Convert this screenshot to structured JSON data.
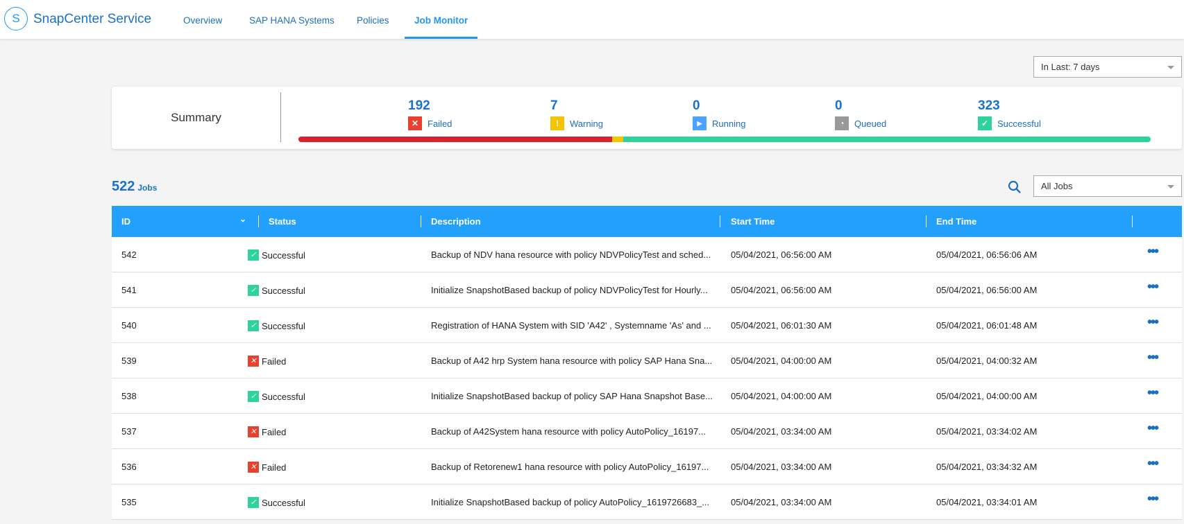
{
  "app": {
    "logo_letter": "S",
    "title": "SnapCenter Service"
  },
  "nav": {
    "tabs": [
      {
        "label": "Overview"
      },
      {
        "label": "SAP HANA Systems"
      },
      {
        "label": "Policies"
      },
      {
        "label": "Job Monitor",
        "active": true
      }
    ]
  },
  "time_filter": {
    "value": "In Last: 7 days"
  },
  "summary": {
    "label": "Summary",
    "stats": [
      {
        "count": "192",
        "label": "Failed",
        "color": "#e8412f",
        "icon": "x-icon"
      },
      {
        "count": "7",
        "label": "Warning",
        "color": "#f5c400",
        "icon": "exclamation-icon"
      },
      {
        "count": "0",
        "label": "Running",
        "color": "#4aa3ff",
        "icon": "play-icon"
      },
      {
        "count": "0",
        "label": "Queued",
        "color": "#999999",
        "icon": "clock-icon"
      },
      {
        "count": "323",
        "label": "Successful",
        "color": "#2ed39b",
        "icon": "check-icon"
      }
    ],
    "bar": {
      "failed": 192,
      "warning": 7,
      "successful": 323,
      "colors": {
        "failed": "#d9222a",
        "warning": "#f5c400",
        "successful": "#2ed39b"
      }
    }
  },
  "jobs": {
    "count": "522",
    "label": "Jobs",
    "filter": "All Jobs"
  },
  "table": {
    "headers": [
      "ID",
      "Status",
      "Description",
      "Start Time",
      "End Time"
    ],
    "rows": [
      {
        "id": "542",
        "status": "Successful",
        "desc": "Backup of NDV hana resource with policy NDVPolicyTest and sched...",
        "start": "05/04/2021, 06:56:00 AM",
        "end": "05/04/2021, 06:56:06 AM"
      },
      {
        "id": "541",
        "status": "Successful",
        "desc": "Initialize SnapshotBased backup of policy NDVPolicyTest for Hourly...",
        "start": "05/04/2021, 06:56:00 AM",
        "end": "05/04/2021, 06:56:00 AM"
      },
      {
        "id": "540",
        "status": "Successful",
        "desc": "Registration of HANA System with SID 'A42' , Systemname 'As' and ...",
        "start": "05/04/2021, 06:01:30 AM",
        "end": "05/04/2021, 06:01:48 AM"
      },
      {
        "id": "539",
        "status": "Failed",
        "desc": "Backup of A42 hrp System hana resource with policy SAP Hana Sna...",
        "start": "05/04/2021, 04:00:00 AM",
        "end": "05/04/2021, 04:00:32 AM"
      },
      {
        "id": "538",
        "status": "Successful",
        "desc": "Initialize SnapshotBased backup of policy SAP Hana Snapshot Base...",
        "start": "05/04/2021, 04:00:00 AM",
        "end": "05/04/2021, 04:00:00 AM"
      },
      {
        "id": "537",
        "status": "Failed",
        "desc": "Backup of A42System hana resource with policy AutoPolicy_16197...",
        "start": "05/04/2021, 03:34:00 AM",
        "end": "05/04/2021, 03:34:02 AM"
      },
      {
        "id": "536",
        "status": "Failed",
        "desc": "Backup of Retorenew1 hana resource with policy AutoPolicy_16197...",
        "start": "05/04/2021, 03:34:00 AM",
        "end": "05/04/2021, 03:34:32 AM"
      },
      {
        "id": "535",
        "status": "Successful",
        "desc": "Initialize SnapshotBased backup of policy AutoPolicy_1619726683_...",
        "start": "05/04/2021, 03:34:00 AM",
        "end": "05/04/2021, 03:34:01 AM"
      }
    ]
  }
}
